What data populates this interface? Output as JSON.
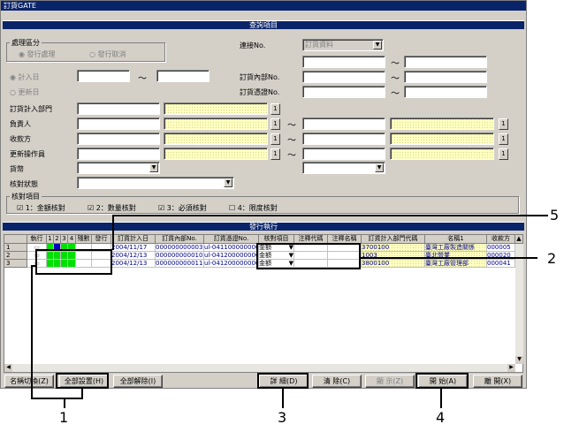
{
  "window": {
    "title": "訂貨GATE"
  },
  "query": {
    "header": "查詢項目",
    "process_group": {
      "label": "處理區分",
      "opt1": "發行處理",
      "opt2": "發行取消"
    },
    "radio_issue_date": "計入日",
    "radio_update_date": "更新日",
    "tilde": "〜",
    "link_no_label": "連接No.",
    "link_no_value": "訂貨資料",
    "order_internal_label": "訂貨內部No.",
    "order_voucher_label": "訂貨憑證No.",
    "dept_label": "訂貨計入部門",
    "person_label": "負責人",
    "receiver_label": "收款方",
    "updater_label": "更新操作員",
    "currency_label": "貨幣",
    "status_label": "核對狀態",
    "check_group": {
      "label": "核對項目",
      "c1": "1：金額核對",
      "c2": "2：數量核對",
      "c3": "3：必須核對",
      "c4": "4：限度核對"
    },
    "btn_1": "1"
  },
  "issue": {
    "header": "發行執行",
    "columns": [
      "執行",
      "1",
      "2",
      "3",
      "4",
      "殘數",
      "發行",
      "訂貨計入日",
      "訂貨內部No.",
      "訂貨憑證No.",
      "核對項目",
      "注釋代碼",
      "注釋名稱",
      "訂貨計入部門代碼",
      "名稱1",
      "收款方"
    ],
    "rows": [
      {
        "n": "1",
        "date": "2004/11/17",
        "internal": "000000000003",
        "voucher": "ul-0411000000003",
        "check": "金額",
        "dept": "3700100",
        "name": "臺灣工廠製造關係",
        "recv": "000005"
      },
      {
        "n": "2",
        "date": "2004/12/13",
        "internal": "000000000010",
        "voucher": "ul-0412000000003",
        "check": "金額",
        "dept": "1003",
        "name": "臺北營業",
        "recv": "000020"
      },
      {
        "n": "3",
        "date": "2004/12/13",
        "internal": "000000000011",
        "voucher": "ul-0412000000004",
        "check": "金額",
        "dept": "3800100",
        "name": "臺灣工廠管理部",
        "recv": "000041"
      }
    ]
  },
  "footer": {
    "name_switch": "名稱切換(Z)",
    "select_all": "全部設置(H)",
    "clear_all": "全部解除(I)",
    "detail": "詳 細(D)",
    "delete": "清 除(C)",
    "display": "顯 示(Z)",
    "start": "開 始(A)",
    "close": "離 開(X)"
  },
  "callouts": {
    "c1": "1",
    "c2": "2",
    "c3": "3",
    "c4": "4",
    "c5": "5"
  }
}
